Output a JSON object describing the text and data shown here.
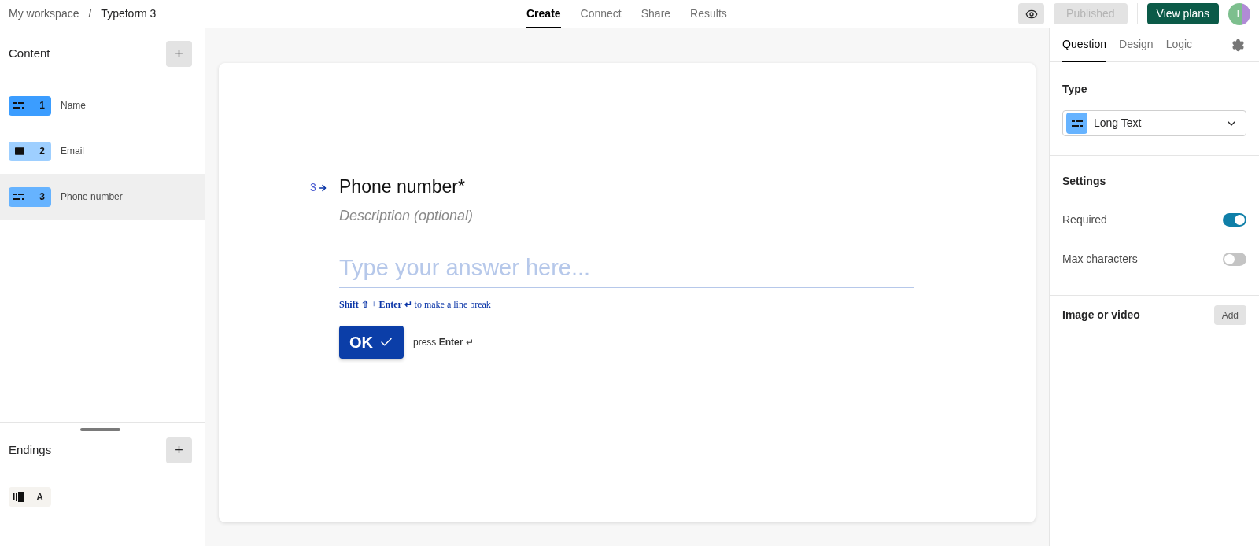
{
  "breadcrumb": [
    "My workspace",
    "/",
    "Typeform 3"
  ],
  "nav_tabs": [
    {
      "label": "Create",
      "selected": true
    },
    {
      "label": "Connect",
      "selected": false
    },
    {
      "label": "Share",
      "selected": false
    },
    {
      "label": "Results",
      "selected": false
    }
  ],
  "header_actions": {
    "published": {
      "label": "Published",
      "disabled": true
    },
    "view_plans": "View plans",
    "avatar": "L"
  },
  "content": {
    "title": "Content",
    "add": "+",
    "items": [
      {
        "kind": "long_text",
        "number": "1",
        "label": "Name",
        "color": "#3b9dff",
        "selected": false
      },
      {
        "kind": "email",
        "number": "2",
        "label": "Email",
        "color": "#9ecfff",
        "selected": false
      },
      {
        "kind": "long_text",
        "number": "3",
        "label": "Phone number",
        "color": "#66b3ff",
        "selected": true
      }
    ]
  },
  "endings": {
    "title": "Endings",
    "add": "+",
    "items": [
      {
        "letter": "A"
      }
    ]
  },
  "question": {
    "number": "3",
    "title": "Phone number*",
    "description": "Description (optional)",
    "placeholder": "Type your answer here...",
    "hint": "**Shift ⇧** + **Enter ↵** to make a line break",
    "ok": "OK",
    "press": "press **Enter** ↵"
  },
  "panel_tabs": [
    {
      "label": "Question",
      "selected": true
    },
    {
      "label": "Design",
      "selected": false
    },
    {
      "label": "Logic",
      "selected": false
    }
  ],
  "type": {
    "title": "Type",
    "value": "Long Text"
  },
  "settings": {
    "title": "Settings",
    "toggles": [
      {
        "label": "Required",
        "on": true
      },
      {
        "label": "Max characters",
        "on": false
      }
    ]
  },
  "media": {
    "label": "Image or video",
    "button": "Add"
  }
}
